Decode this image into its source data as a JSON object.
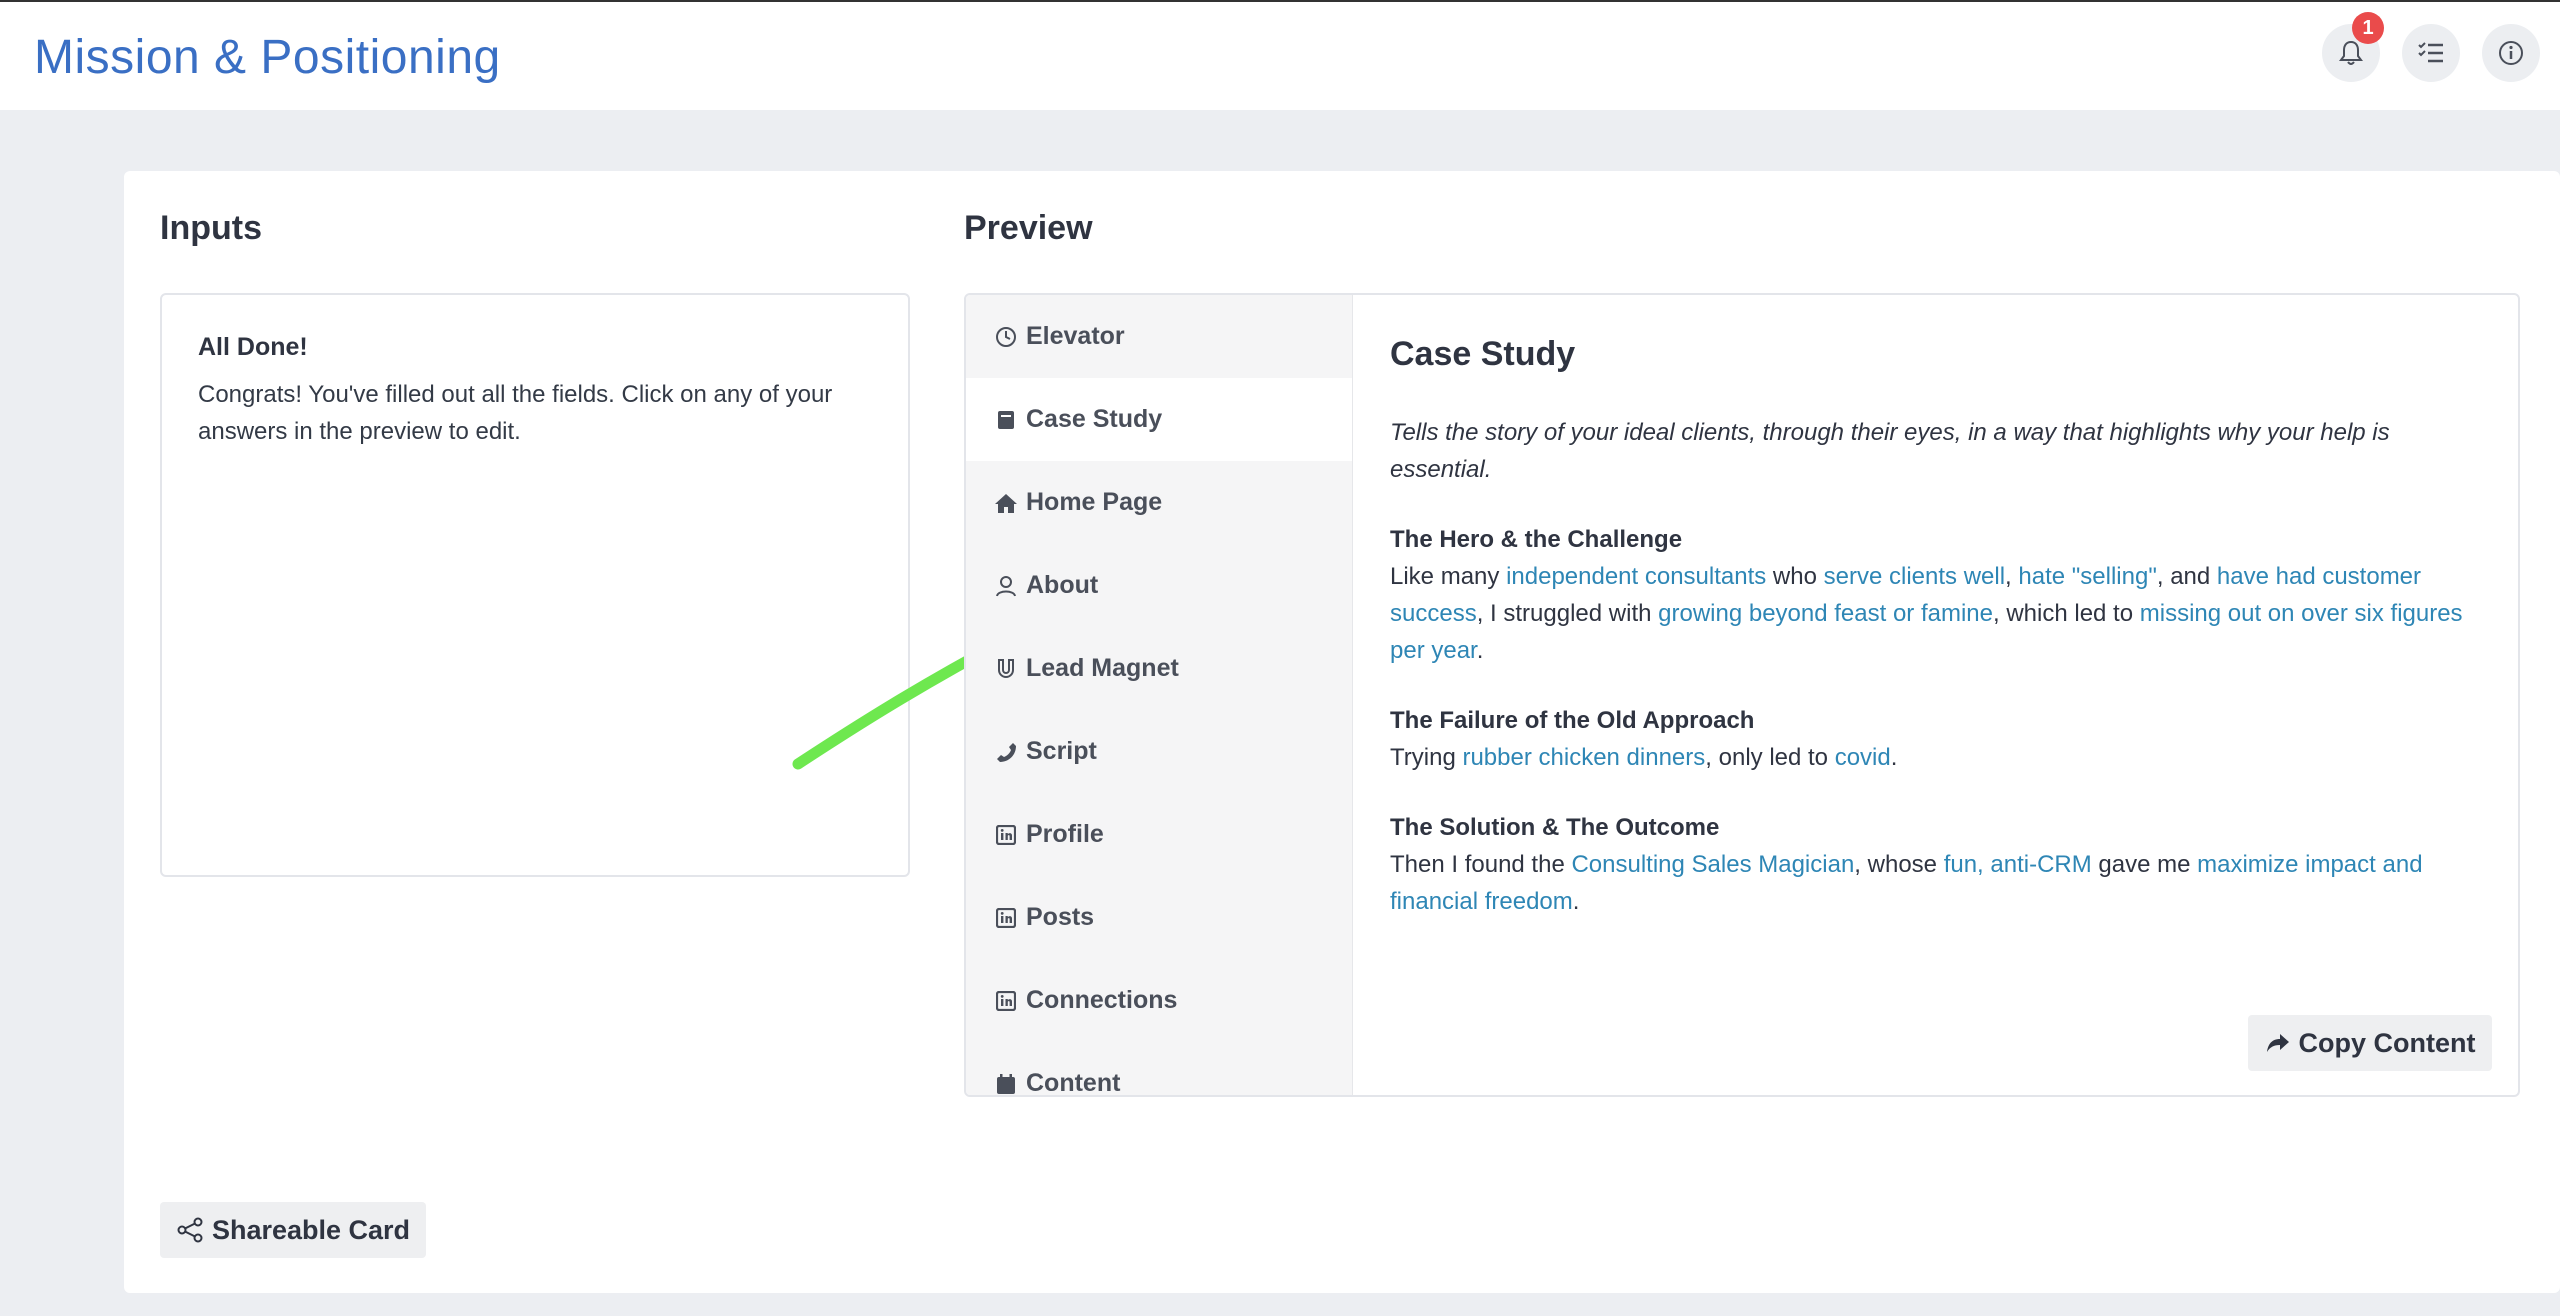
{
  "header": {
    "title": "Mission & Positioning",
    "notification_count": "1",
    "icons": [
      "bell-icon",
      "checklist-icon",
      "info-icon"
    ]
  },
  "inputs": {
    "heading": "Inputs",
    "done_title": "All Done!",
    "done_text": "Congrats! You've filled out all the fields. Click on any of your answers in the preview to edit."
  },
  "preview": {
    "heading": "Preview",
    "tabs": [
      {
        "label": "Elevator",
        "icon": "clock-icon"
      },
      {
        "label": "Case Study",
        "icon": "book-icon"
      },
      {
        "label": "Home Page",
        "icon": "home-icon"
      },
      {
        "label": "About",
        "icon": "user-icon"
      },
      {
        "label": "Lead Magnet",
        "icon": "magnet-icon"
      },
      {
        "label": "Script",
        "icon": "phone-icon"
      },
      {
        "label": "Profile",
        "icon": "linkedin-icon"
      },
      {
        "label": "Posts",
        "icon": "linkedin-icon"
      },
      {
        "label": "Connections",
        "icon": "linkedin-icon"
      },
      {
        "label": "Content",
        "icon": "calendar-icon"
      }
    ],
    "active_tab": "Case Study",
    "content": {
      "title": "Case Study",
      "intro": "Tells the story of your ideal clients, through their eyes, in a way that highlights why your help is essential.",
      "hero": {
        "title": "The Hero & the Challenge",
        "t1": "Like many ",
        "l1": "independent consultants",
        "t2": " who ",
        "l2": "serve clients well",
        "t3": ", ",
        "l3": "hate \"selling\"",
        "t4": ", and ",
        "l4": "have had customer success",
        "t5": ", I struggled with ",
        "l5": "growing beyond feast or famine",
        "t6": ", which led to ",
        "l6": "missing out on over six figures per year",
        "t7": "."
      },
      "failure": {
        "title": "The Failure of the Old Approach",
        "t1": "Trying ",
        "l1": "rubber chicken dinners",
        "t2": ", only led to ",
        "l2": "covid",
        "t3": "."
      },
      "solution": {
        "title": "The Solution & The Outcome",
        "t1": "Then I found the ",
        "l1": "Consulting Sales Magician",
        "t2": ", whose ",
        "l2": "fun, anti-CRM",
        "t3": " gave me ",
        "l3": "maximize impact and financial freedom",
        "t4": "."
      },
      "copy_button": "Copy Content"
    }
  },
  "footer": {
    "share_button": "Shareable Card"
  },
  "colors": {
    "title_blue": "#3a6fc4",
    "link_blue": "#2e86b5",
    "badge_red": "#ea4b4b",
    "arrow_green": "#6ee84f"
  }
}
